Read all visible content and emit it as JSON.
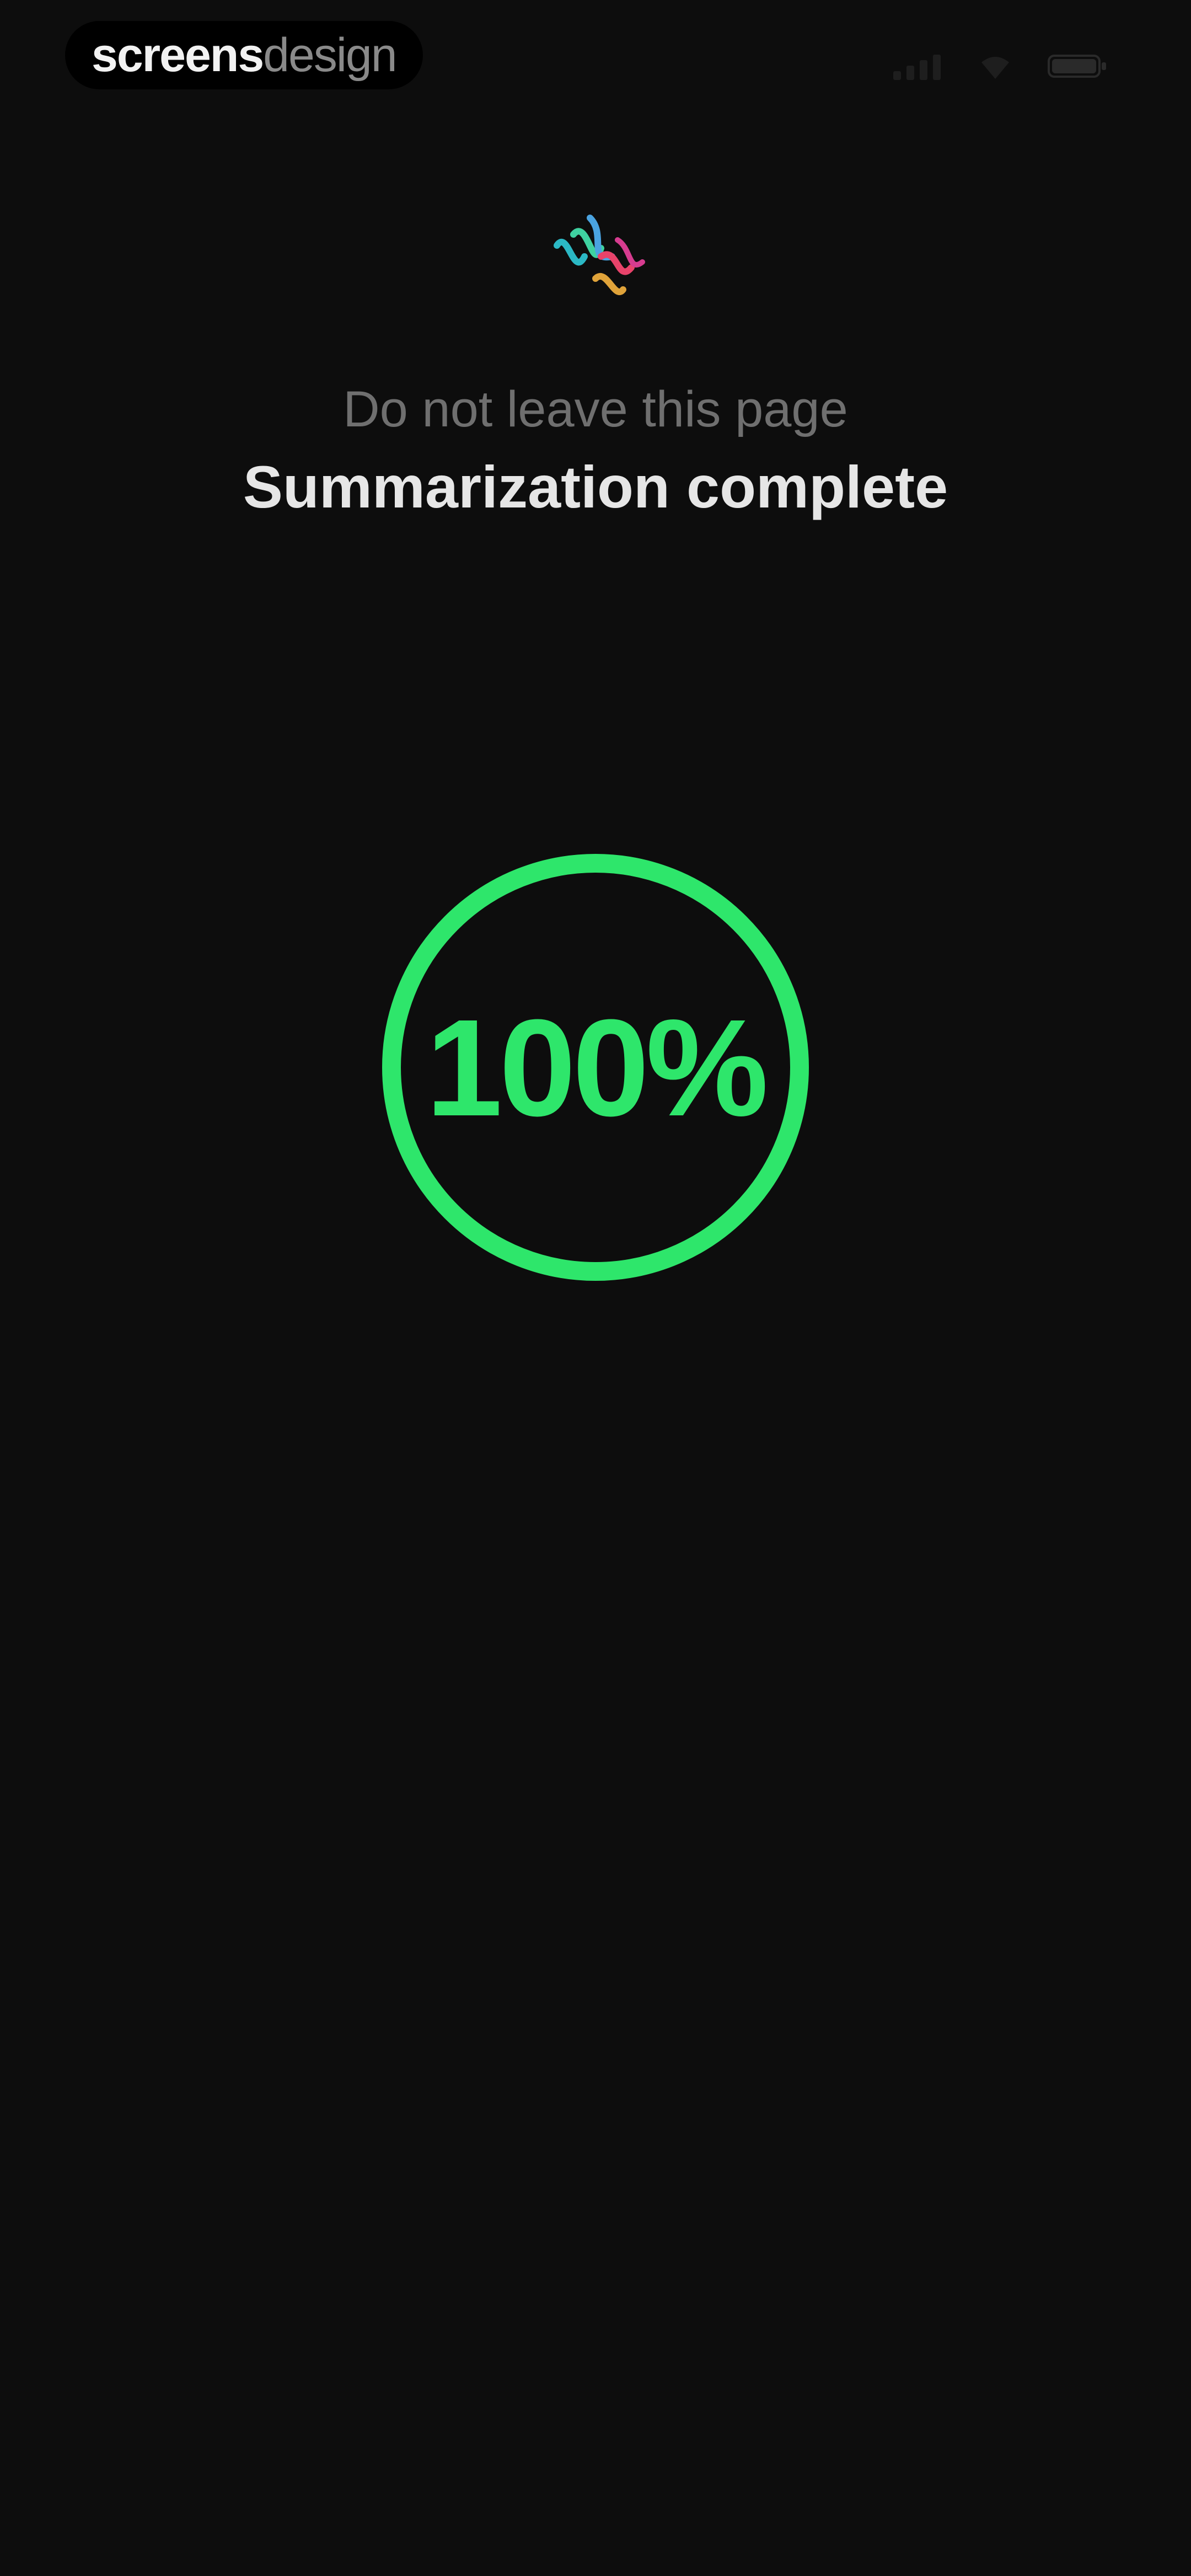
{
  "watermark": {
    "bold_part": "screens",
    "light_part": "design"
  },
  "status_bar": {
    "icons": [
      "signal-icon",
      "wifi-icon",
      "battery-icon"
    ]
  },
  "app": {
    "logo_icon": "multicolor-brushstroke-logo-icon"
  },
  "header": {
    "subtitle": "Do not leave this page",
    "title": "Summarization complete"
  },
  "progress": {
    "value": 1.0,
    "label": "100%",
    "color": "#2ee66b"
  },
  "colors": {
    "background": "#0d0d0d",
    "accent": "#2ee66b"
  }
}
